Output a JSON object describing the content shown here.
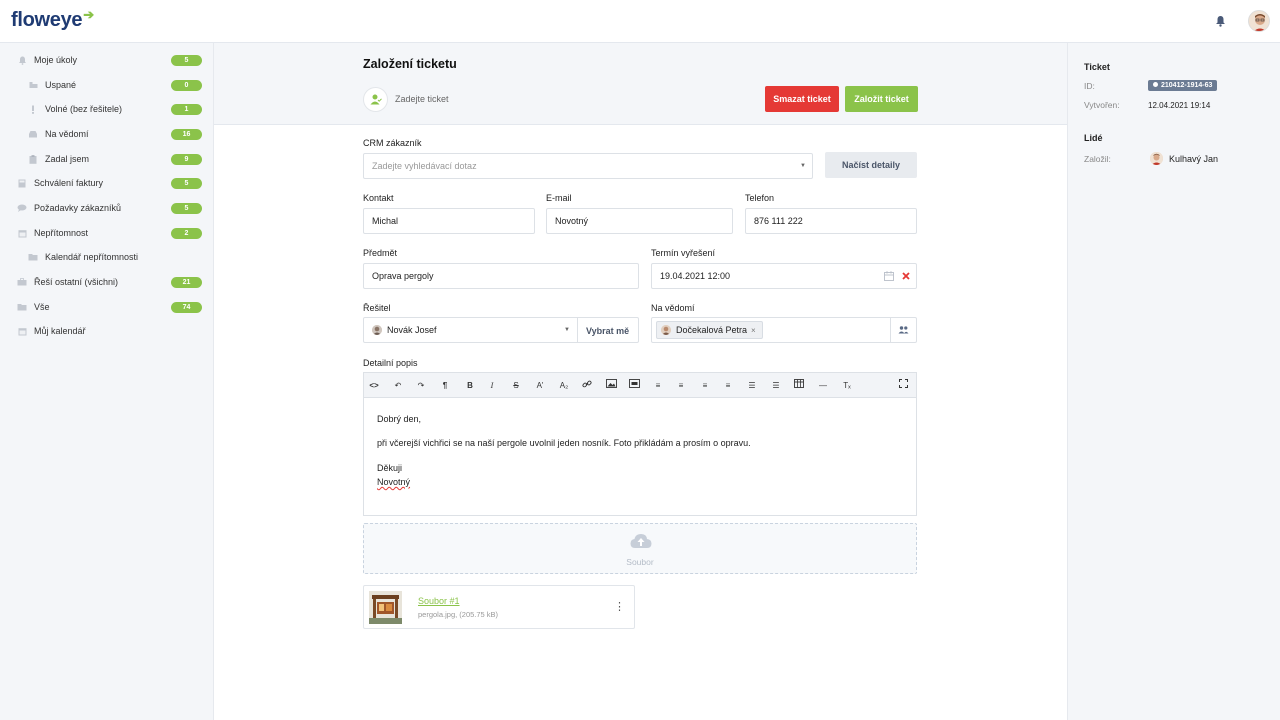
{
  "brand": {
    "name": "floweye"
  },
  "sidebar": {
    "items": [
      {
        "label": "Moje úkoly",
        "badge": "5",
        "icon": "bell-icon"
      },
      {
        "label": "Uspané",
        "badge": "0",
        "icon": "sleep-icon"
      },
      {
        "label": "Volné (bez řešitele)",
        "badge": "1",
        "icon": "exclamation-icon"
      },
      {
        "label": "Na vědomí",
        "badge": "16",
        "icon": "inbox-icon"
      },
      {
        "label": "Zadal jsem",
        "badge": "9",
        "icon": "clipboard-icon"
      },
      {
        "label": "Schválení faktury",
        "badge": "5",
        "icon": "calculator-icon"
      },
      {
        "label": "Požadavky zákazníků",
        "badge": "5",
        "icon": "chat-icon"
      },
      {
        "label": "Nepřítomnost",
        "badge": "2",
        "icon": "calendar-icon"
      },
      {
        "label": "Kalendář nepřítomnosti",
        "badge": "",
        "icon": "folder-icon"
      },
      {
        "label": "Řeší ostatní (všichni)",
        "badge": "21",
        "icon": "briefcase-icon"
      },
      {
        "label": "Vše",
        "badge": "74",
        "icon": "folder-icon"
      },
      {
        "label": "Můj kalendář",
        "badge": "",
        "icon": "calendar-icon"
      }
    ]
  },
  "header": {
    "title": "Založení ticketu",
    "assignee_placeholder": "Zadejte ticket",
    "delete_label": "Smazat ticket",
    "create_label": "Založit ticket"
  },
  "form": {
    "crm_label": "CRM zákazník",
    "crm_placeholder": "Zadejte vyhledávací dotaz",
    "load_details_label": "Načíst detaily",
    "contact_label": "Kontakt",
    "contact_value": "Michal",
    "email_label": "E-mail",
    "email_value": "Novotný",
    "phone_label": "Telefon",
    "phone_value": "876 111 222",
    "subject_label": "Předmět",
    "subject_value": "Oprava pergoly",
    "deadline_label": "Termín vyřešení",
    "deadline_value": "19.04.2021 12:00",
    "solver_label": "Řešitel",
    "solver_value": "Novák Josef",
    "pick_me_label": "Vybrat mě",
    "cc_label": "Na vědomí",
    "cc_tag": "Dočekalová Petra",
    "description_label": "Detailní popis"
  },
  "editor": {
    "lines": [
      "Dobrý den,",
      "při včerejší vichřici se na naší pergole uvolnil jeden nosník. Foto přikládám a prosím o opravu.",
      "Děkuji",
      "Novotný"
    ]
  },
  "upload": {
    "label": "Soubor"
  },
  "attachment": {
    "name": "Soubor #1",
    "meta": "pergola.jpg, (205.75 kB)"
  },
  "right_panel": {
    "ticket_heading": "Ticket",
    "id_label": "ID:",
    "id_value": "210412-1914-63",
    "created_label": "Vytvořen:",
    "created_value": "12.04.2021 19:14",
    "people_heading": "Lidé",
    "founder_label": "Založil:",
    "founder_value": "Kulhavý Jan"
  },
  "colors": {
    "accent": "#8bc34a",
    "danger": "#e53935",
    "brand": "#1f3b73"
  }
}
